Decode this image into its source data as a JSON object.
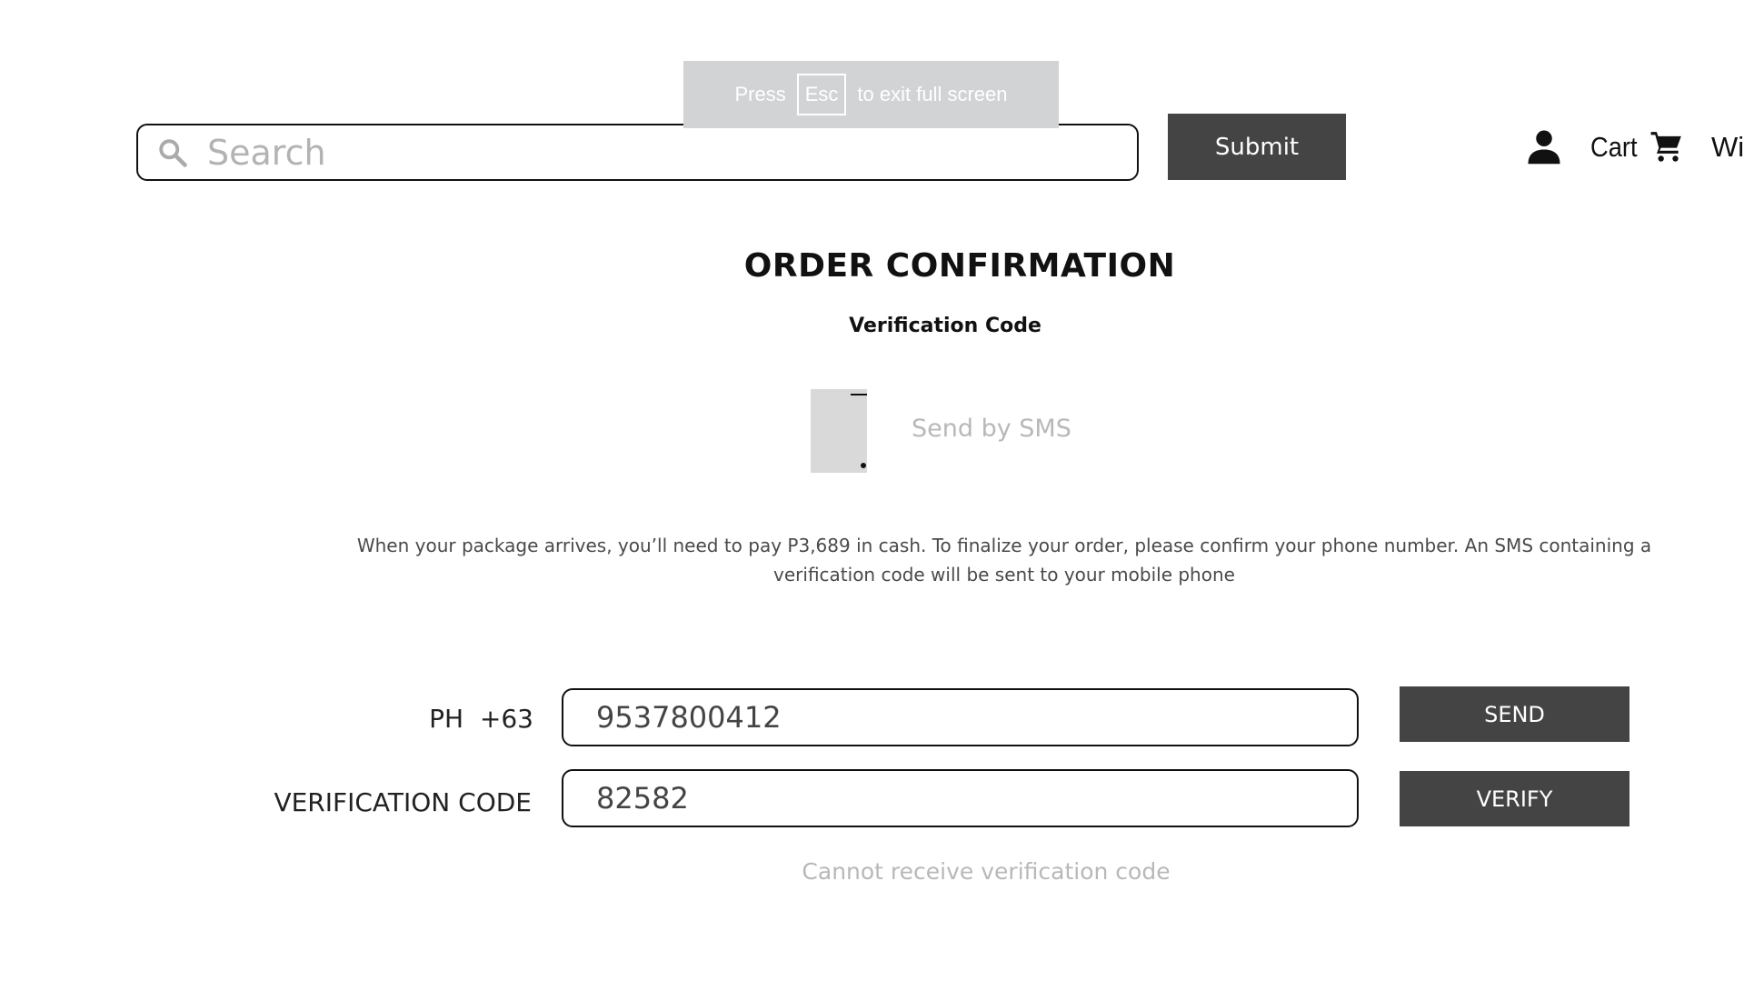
{
  "fullscreen_notice": {
    "press": "Press",
    "key": "Esc",
    "suffix": "to exit full screen"
  },
  "header": {
    "search_placeholder": "Search",
    "submit_label": "Submit",
    "cart_label": "Cart",
    "wishlist_label": "Wishlist",
    "icons": [
      "search-icon",
      "user-icon",
      "cart-icon"
    ]
  },
  "main": {
    "title": "ORDER CONFIRMATION",
    "subtitle": "Verification Code",
    "send_by_sms": "Send by SMS",
    "description": "When your package arrives, you’ll need to pay P3,689 in cash. To finalize your order, please confirm your phone number. An SMS containing a verification code will be sent to your mobile phone",
    "phone_label": "PH  +63",
    "phone_value": "9537800412",
    "send_label": "SEND",
    "code_label": "VERIFICATION CODE",
    "code_value": "82582",
    "verify_label": "VERIFY",
    "cannot_receive": "Cannot receive verification code"
  },
  "colors": {
    "button_bg": "#444444",
    "muted_text": "#b8b8b8",
    "notice_bg": "#d2d3d5"
  }
}
